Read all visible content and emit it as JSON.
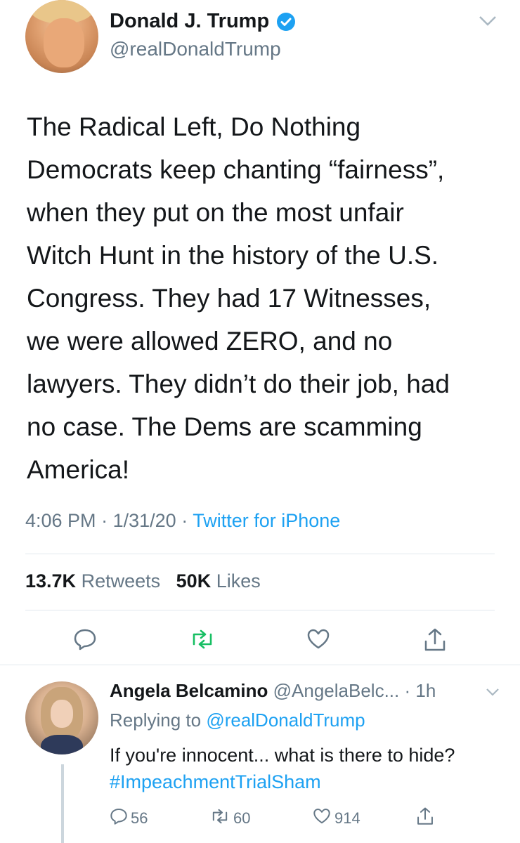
{
  "tweet": {
    "author_name": "Donald J. Trump",
    "author_handle": "@realDonaldTrump",
    "text": "The Radical Left, Do Nothing\nDemocrats keep chanting “fairness”,\nwhen they put on the most unfair\nWitch Hunt in the history of the U.S.\nCongress. They had 17 Witnesses,\nwe were allowed ZERO, and no\nlawyers. They didn’t do their job, had\nno case. The Dems are scamming\nAmerica!",
    "time": "4:06 PM",
    "date": "1/31/20",
    "separator": "·",
    "source": "Twitter for iPhone",
    "retweets_count": "13.7K",
    "retweets_label": "Retweets",
    "likes_count": "50K",
    "likes_label": "Likes"
  },
  "reply": {
    "author_name": "Angela Belcamino",
    "author_handle": "@AngelaBelc...",
    "time_ago": "1h",
    "separator": "·",
    "replying_prefix": "Replying to",
    "replying_to": "@realDonaldTrump",
    "text": "If you're innocent... what is there to hide?",
    "hashtag": "#ImpeachmentTrialSham",
    "reply_count": "56",
    "retweet_count": "60",
    "like_count": "914"
  },
  "colors": {
    "accent": "#1da1f2",
    "secondary_text": "#657786",
    "retweet_green": "#17bf63",
    "divider": "#e1e8ed"
  },
  "icons": [
    "verified-badge-icon",
    "chevron-down-icon",
    "reply-icon",
    "retweet-icon",
    "like-icon",
    "share-icon"
  ]
}
